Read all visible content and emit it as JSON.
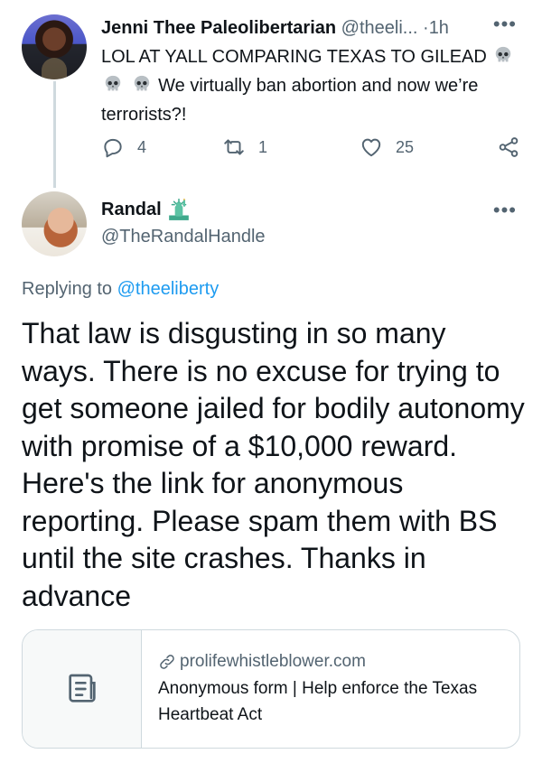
{
  "parent_tweet": {
    "name": "Jenni Thee Paleolibertarian",
    "handle": "@theeli...",
    "separator": "·",
    "time": "1h",
    "more": "•••",
    "text_line1": "LOL AT YALL COMPARING TEXAS TO GILEAD",
    "text_line2": "We virtually ban abortion and now we’re",
    "text_line3": "terrorists?!",
    "emoji": "skull-emoji",
    "replies": "4",
    "retweets": "1",
    "likes": "25"
  },
  "main_tweet": {
    "name": "Randal",
    "badge_emoji": "statue-of-liberty-emoji",
    "handle": "@TheRandalHandle",
    "more": "•••",
    "replying_prefix": "Replying to",
    "replying_to": "@theeliberty",
    "text": "That law is disgusting in so many ways. There is no excuse for trying to get someone jailed for bodily autonomy with promise of a $10,000 reward. Here's the link for anonymous reporting. Please spam them with BS until the site crashes. Thanks in advance"
  },
  "link_card": {
    "domain": "prolifewhistleblower.com",
    "title": "Anonymous form | Help enforce the Texas Heartbeat Act",
    "thumb_icon": "document-icon",
    "domain_icon": "link-icon"
  },
  "colors": {
    "text": "#0f1419",
    "secondary": "#536471",
    "link": "#1d9bf0",
    "border": "#cfd9de"
  }
}
